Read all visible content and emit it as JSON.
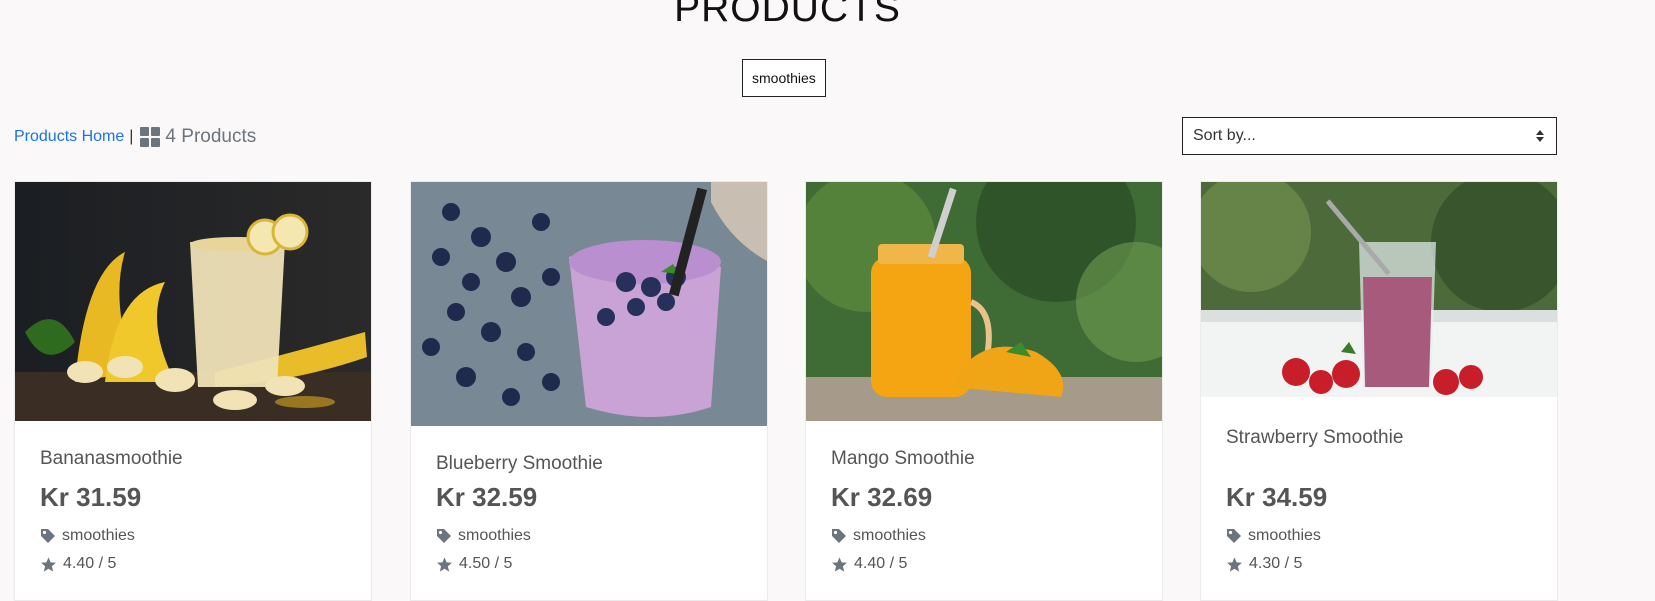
{
  "header": {
    "title": "PRODUCTS",
    "active_tag": "smoothies"
  },
  "toolbar": {
    "home_link": "Products Home",
    "separator": "|",
    "product_count": "4 Products",
    "sort_placeholder": "Sort by..."
  },
  "products": [
    {
      "name": "Bananasmoothie",
      "price": "Kr 31.59",
      "category": "smoothies",
      "rating": "4.40 / 5"
    },
    {
      "name": "Blueberry Smoothie",
      "price": "Kr 32.59",
      "category": "smoothies",
      "rating": "4.50 / 5"
    },
    {
      "name": "Mango Smoothie",
      "price": "Kr 32.69",
      "category": "smoothies",
      "rating": "4.40 / 5"
    },
    {
      "name": "Strawberry Smoothie",
      "price": "Kr 34.59",
      "category": "smoothies",
      "rating": "4.30 / 5"
    }
  ],
  "colors": {
    "link": "#1a73e8",
    "icon_gray": "#6c757d",
    "page_bg": "#faf8f9"
  }
}
